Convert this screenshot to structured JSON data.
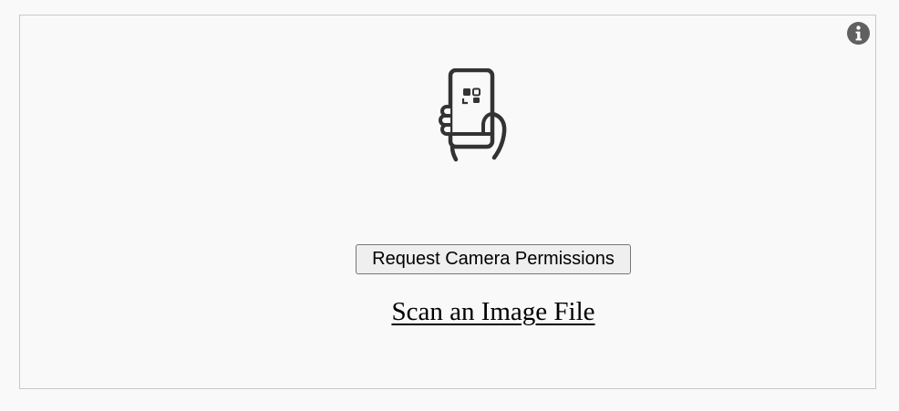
{
  "scanner": {
    "info_icon": "info-icon",
    "illustration_icon": "phone-scan-qr-icon",
    "request_permission_label": "Request Camera Permissions",
    "scan_file_label": "Scan an Image File"
  },
  "colors": {
    "background": "#f9f9f9",
    "border": "#c8c8c8",
    "icon": "#333333",
    "info_icon": "#606060"
  }
}
